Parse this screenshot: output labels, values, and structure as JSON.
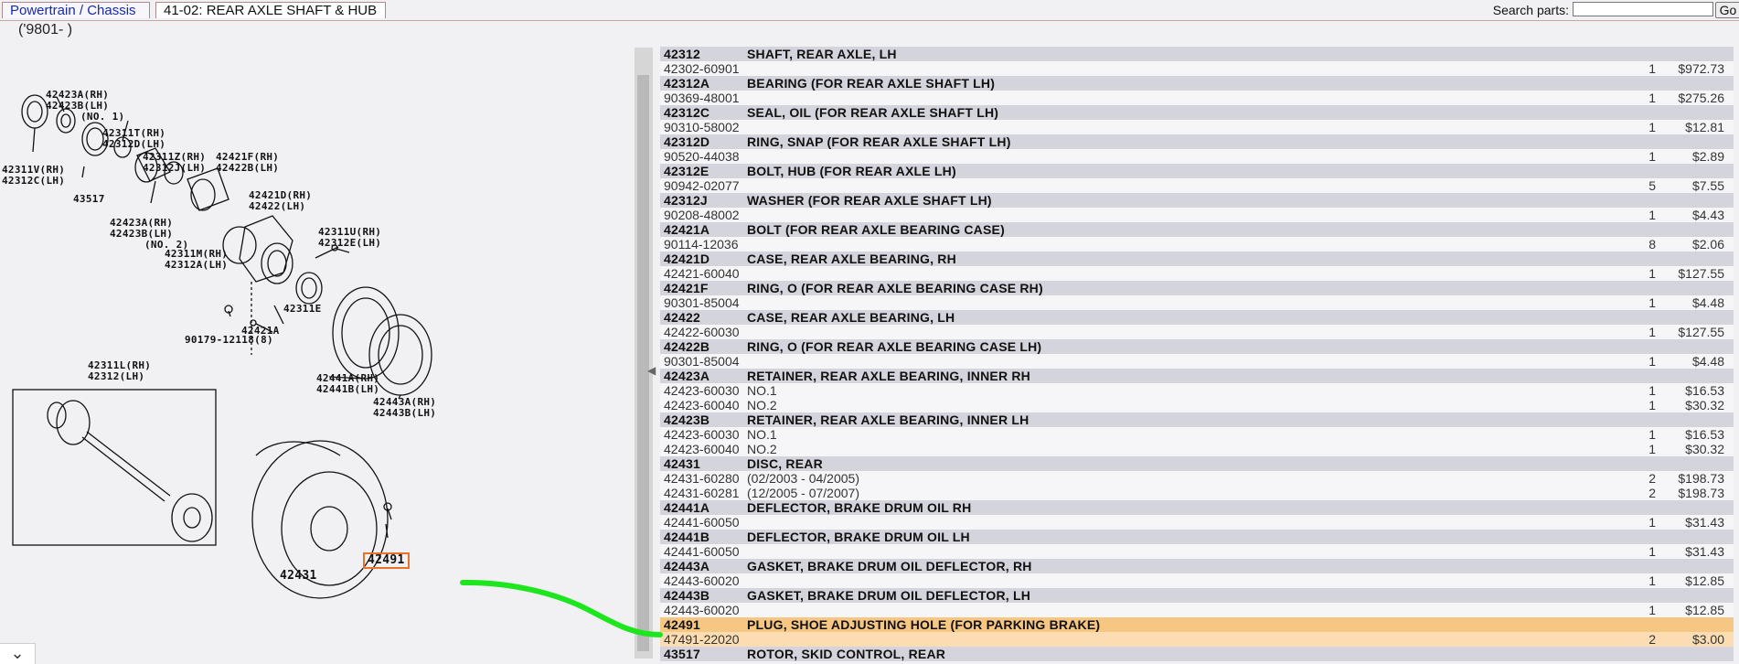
{
  "tabs": [
    {
      "label": "Powertrain / Chassis"
    },
    {
      "label": "41-02: REAR AXLE SHAFT & HUB"
    }
  ],
  "search": {
    "label": "Search parts:",
    "placeholder": "",
    "value": "",
    "go_label": "Go"
  },
  "date_range": "('9801-      )",
  "diagram": {
    "callouts": [
      "42423A(RH)",
      "42423B(LH)",
      "(NO. 1)",
      "42311T(RH)",
      "42312D(LH)",
      "42311Z(RH)",
      "42312J(LH)",
      "42421F(RH)",
      "42422B(LH)",
      "42311V(RH)",
      "42312C(LH)",
      "43517",
      "42421D(RH)",
      "42422(LH)",
      "42423A(RH)",
      "42423B(LH)",
      "(NO. 2)",
      "42311M(RH)",
      "42312A(LH)",
      "42311U(RH)",
      "42312E(LH)",
      "42311E",
      "42421A",
      "90179-12118(8)",
      "42311L(RH)",
      "42312(LH)",
      "42441A(RH)",
      "42441B(LH)",
      "42443A(RH)",
      "42443B(LH)",
      "42491",
      "42431"
    ]
  },
  "parts": [
    {
      "num": "42312",
      "desc": "SHAFT, REAR AXLE, LH",
      "subs": [
        {
          "pn": "42302-60901",
          "note": "",
          "qty": "1",
          "price": "$972.73"
        }
      ]
    },
    {
      "num": "42312A",
      "desc": "BEARING (FOR REAR AXLE SHAFT LH)",
      "subs": [
        {
          "pn": "90369-48001",
          "note": "",
          "qty": "1",
          "price": "$275.26"
        }
      ]
    },
    {
      "num": "42312C",
      "desc": "SEAL, OIL (FOR REAR AXLE SHAFT LH)",
      "subs": [
        {
          "pn": "90310-58002",
          "note": "",
          "qty": "1",
          "price": "$12.81"
        }
      ]
    },
    {
      "num": "42312D",
      "desc": "RING, SNAP (FOR REAR AXLE SHAFT LH)",
      "subs": [
        {
          "pn": "90520-44038",
          "note": "",
          "qty": "1",
          "price": "$2.89"
        }
      ]
    },
    {
      "num": "42312E",
      "desc": "BOLT, HUB (FOR REAR AXLE LH)",
      "subs": [
        {
          "pn": "90942-02077",
          "note": "",
          "qty": "5",
          "price": "$7.55"
        }
      ]
    },
    {
      "num": "42312J",
      "desc": "WASHER (FOR REAR AXLE SHAFT LH)",
      "subs": [
        {
          "pn": "90208-48002",
          "note": "",
          "qty": "1",
          "price": "$4.43"
        }
      ]
    },
    {
      "num": "42421A",
      "desc": "BOLT (FOR REAR AXLE BEARING CASE)",
      "subs": [
        {
          "pn": "90114-12036",
          "note": "",
          "qty": "8",
          "price": "$2.06"
        }
      ]
    },
    {
      "num": "42421D",
      "desc": "CASE, REAR AXLE BEARING, RH",
      "subs": [
        {
          "pn": "42421-60040",
          "note": "",
          "qty": "1",
          "price": "$127.55"
        }
      ]
    },
    {
      "num": "42421F",
      "desc": "RING, O (FOR REAR AXLE BEARING CASE RH)",
      "subs": [
        {
          "pn": "90301-85004",
          "note": "",
          "qty": "1",
          "price": "$4.48"
        }
      ]
    },
    {
      "num": "42422",
      "desc": "CASE, REAR AXLE BEARING, LH",
      "subs": [
        {
          "pn": "42422-60030",
          "note": "",
          "qty": "1",
          "price": "$127.55"
        }
      ]
    },
    {
      "num": "42422B",
      "desc": "RING, O (FOR REAR AXLE BEARING CASE LH)",
      "subs": [
        {
          "pn": "90301-85004",
          "note": "",
          "qty": "1",
          "price": "$4.48"
        }
      ]
    },
    {
      "num": "42423A",
      "desc": "RETAINER, REAR AXLE BEARING, INNER RH",
      "subs": [
        {
          "pn": "42423-60030",
          "note": "NO.1",
          "qty": "1",
          "price": "$16.53"
        },
        {
          "pn": "42423-60040",
          "note": "NO.2",
          "qty": "1",
          "price": "$30.32"
        }
      ]
    },
    {
      "num": "42423B",
      "desc": "RETAINER, REAR AXLE BEARING, INNER LH",
      "subs": [
        {
          "pn": "42423-60030",
          "note": "NO.1",
          "qty": "1",
          "price": "$16.53"
        },
        {
          "pn": "42423-60040",
          "note": "NO.2",
          "qty": "1",
          "price": "$30.32"
        }
      ]
    },
    {
      "num": "42431",
      "desc": "DISC, REAR",
      "subs": [
        {
          "pn": "42431-60280",
          "note": "(02/2003 - 04/2005)",
          "qty": "2",
          "price": "$198.73"
        },
        {
          "pn": "42431-60281",
          "note": "(12/2005 - 07/2007)",
          "qty": "2",
          "price": "$198.73"
        }
      ]
    },
    {
      "num": "42441A",
      "desc": "DEFLECTOR, BRAKE DRUM OIL RH",
      "subs": [
        {
          "pn": "42441-60050",
          "note": "",
          "qty": "1",
          "price": "$31.43"
        }
      ]
    },
    {
      "num": "42441B",
      "desc": "DEFLECTOR, BRAKE DRUM OIL LH",
      "subs": [
        {
          "pn": "42441-60050",
          "note": "",
          "qty": "1",
          "price": "$31.43"
        }
      ]
    },
    {
      "num": "42443A",
      "desc": "GASKET, BRAKE DRUM OIL DEFLECTOR, RH",
      "subs": [
        {
          "pn": "42443-60020",
          "note": "",
          "qty": "1",
          "price": "$12.85"
        }
      ]
    },
    {
      "num": "42443B",
      "desc": "GASKET, BRAKE DRUM OIL DEFLECTOR, LH",
      "subs": [
        {
          "pn": "42443-60020",
          "note": "",
          "qty": "1",
          "price": "$12.85"
        }
      ]
    },
    {
      "num": "42491",
      "desc": "PLUG, SHOE ADJUSTING HOLE (FOR PARKING BRAKE)",
      "highlight": true,
      "subs": [
        {
          "pn": "47491-22020",
          "note": "",
          "qty": "2",
          "price": "$3.00"
        }
      ]
    },
    {
      "num": "43517",
      "desc": "ROTOR, SKID CONTROL, REAR",
      "subs": []
    }
  ],
  "colors": {
    "highlight_header": "#f6c683",
    "highlight_sub": "#fcddb3",
    "annotation": "#1ee61e",
    "callout_box": "#e8722a",
    "tab_link": "#1a2aa5"
  }
}
